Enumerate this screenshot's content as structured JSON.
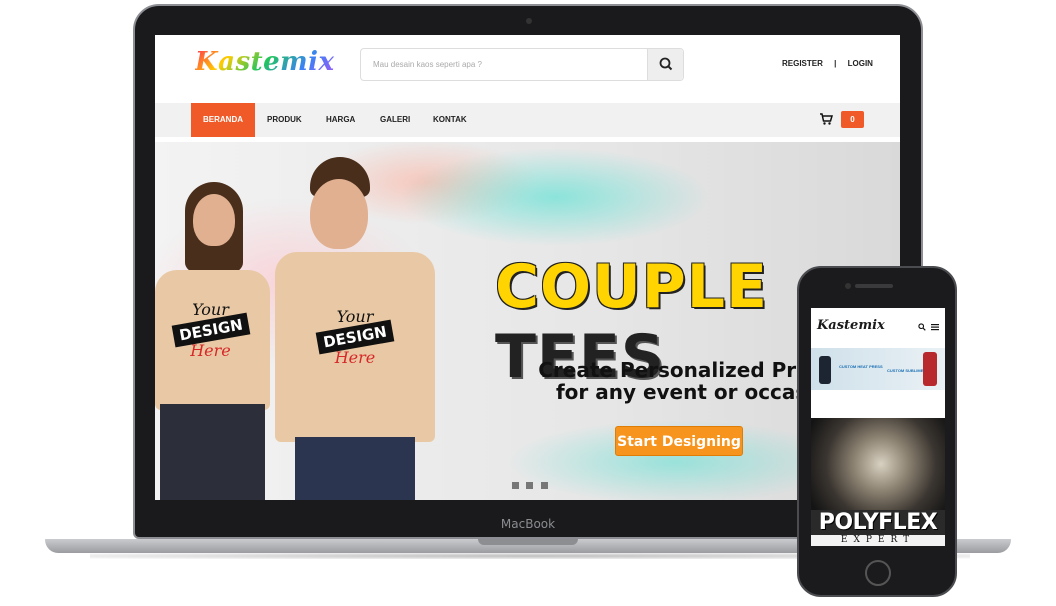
{
  "laptop": {
    "brand": "MacBook"
  },
  "site": {
    "logo": "Kastemix",
    "search": {
      "placeholder": "Mau desain kaos seperti apa ?"
    },
    "auth": {
      "register": "REGISTER",
      "separator": "|",
      "login": "LOGIN"
    },
    "nav": {
      "items": [
        {
          "label": "BERANDA",
          "active": true
        },
        {
          "label": "PRODUK",
          "active": false
        },
        {
          "label": "HARGA",
          "active": false
        },
        {
          "label": "GALERI",
          "active": false
        },
        {
          "label": "KONTAK",
          "active": false
        }
      ]
    },
    "cart": {
      "count": "0"
    },
    "hero": {
      "headline_part1": "COUPLE",
      "headline_part2": "TEES",
      "subline1": "Create Personalized Products",
      "subline2": "for any event or occassion",
      "cta": "Start Designing",
      "slide_count": 3,
      "active_slide": 1,
      "shirt_print": {
        "line1": "Your",
        "line2": "DESIGN",
        "line3": "Here"
      }
    },
    "colors": {
      "accent": "#f05a28",
      "cta": "#f7941d",
      "yellow": "#ffd400"
    }
  },
  "phone": {
    "logo": "Kastemix",
    "banner_labels": [
      "CUSTOM HEAT PRESS",
      "CUSTOM SUBLIME"
    ],
    "promo_title": "POLYFLEX",
    "promo_subtitle": "EXPERT"
  }
}
